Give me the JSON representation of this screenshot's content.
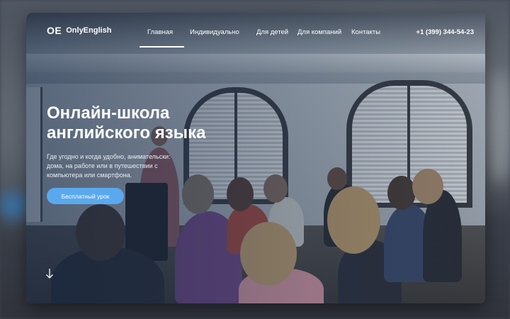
{
  "brand": {
    "mark": "OE",
    "name": "OnlyEnglish"
  },
  "nav": {
    "items": [
      {
        "label": "Главная",
        "active": true
      },
      {
        "label": "Индивидуально",
        "active": false
      },
      {
        "label": "Для детей",
        "active": false
      },
      {
        "label": "Для компаний",
        "active": false
      },
      {
        "label": "Контакты",
        "active": false
      }
    ],
    "phone": "+1 (399) 344-54-23"
  },
  "hero": {
    "title_line1": "Онлайн-школа",
    "title_line2": "английского языка",
    "text_line1": "Где угодно и когда удобно, анимательски:",
    "text_line2": "дома, на работе или в путешествии с",
    "text_line3": "компьютера или смартфона.",
    "cta_label": "Бесплатный урок",
    "scroll_icon": "arrow-down-icon"
  },
  "colors": {
    "accent": "#5aa9ee",
    "text": "#ffffff"
  }
}
